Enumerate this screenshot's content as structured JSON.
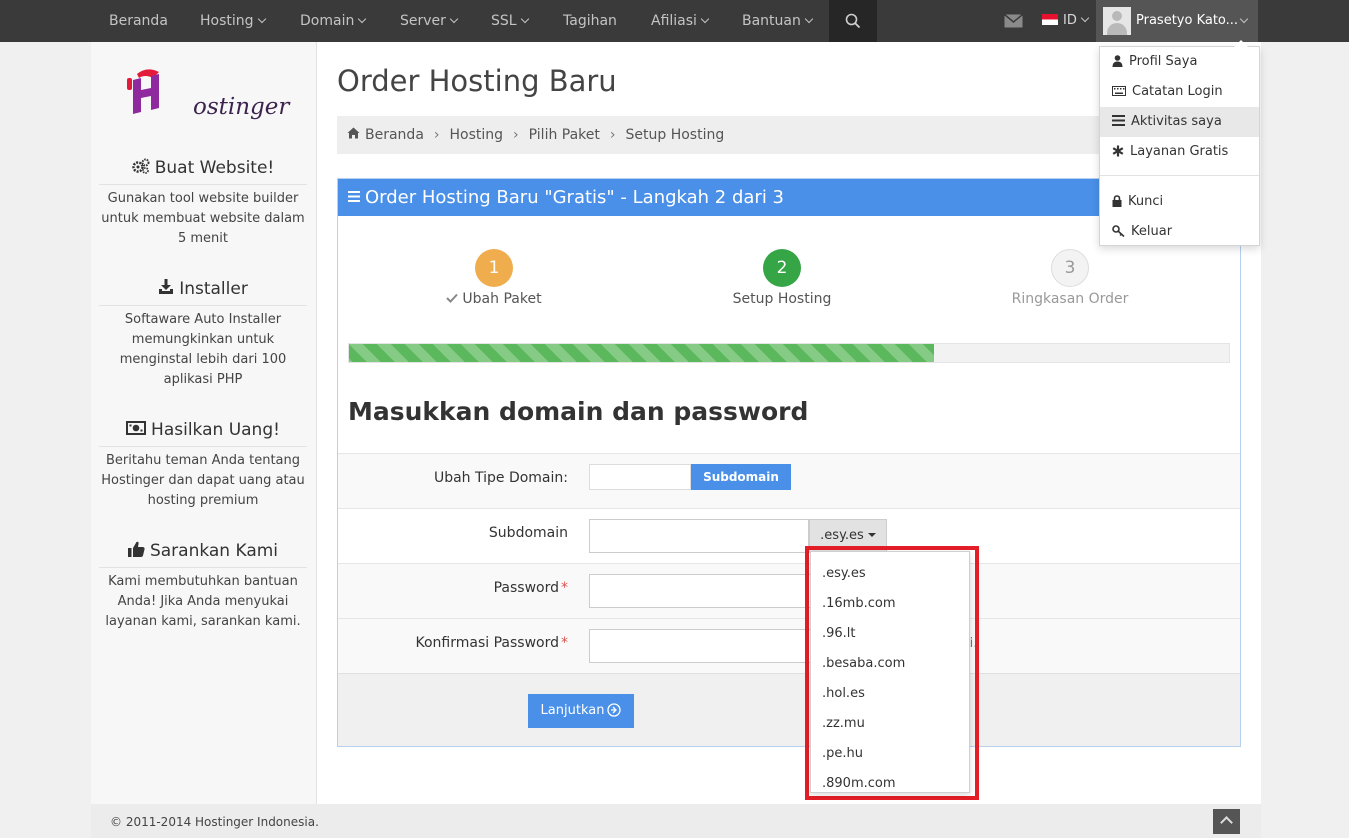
{
  "nav": {
    "items": [
      {
        "label": "Beranda",
        "has_menu": false
      },
      {
        "label": "Hosting",
        "has_menu": true
      },
      {
        "label": "Domain",
        "has_menu": true
      },
      {
        "label": "Server",
        "has_menu": true
      },
      {
        "label": "SSL",
        "has_menu": true
      },
      {
        "label": "Tagihan",
        "has_menu": false
      },
      {
        "label": "Afiliasi",
        "has_menu": true
      },
      {
        "label": "Bantuan",
        "has_menu": true
      }
    ],
    "search_icon": "search-icon",
    "mail_icon": "envelope-icon",
    "language": "ID",
    "user_name": "Prasetyo Kato..."
  },
  "user_menu": {
    "items": [
      {
        "label": "Profil Saya",
        "icon": "user-icon"
      },
      {
        "label": "Catatan Login",
        "icon": "keyboard-icon"
      },
      {
        "label": "Aktivitas saya",
        "icon": "list-icon",
        "active": true
      },
      {
        "label": "Layanan Gratis",
        "icon": "asterisk-icon"
      },
      {
        "label": "Kunci",
        "icon": "lock-icon"
      },
      {
        "label": "Keluar",
        "icon": "key-icon"
      }
    ]
  },
  "sidebar": {
    "logo_text": "ostinger",
    "sections": [
      {
        "title": "Buat Website!",
        "icon": "cogs-icon",
        "text": "Gunakan tool website builder untuk membuat website dalam 5 menit"
      },
      {
        "title": "Installer",
        "icon": "download-icon",
        "text": "Softaware Auto Installer memungkinkan untuk menginstal lebih dari 100 aplikasi PHP"
      },
      {
        "title": "Hasilkan Uang!",
        "icon": "money-icon",
        "text": "Beritahu teman Anda tentang Hostinger dan dapat uang atau hosting premium"
      },
      {
        "title": "Sarankan Kami",
        "icon": "thumbs-up-icon",
        "text": "Kami membutuhkan bantuan Anda! Jika Anda menyukai layanan kami, sarankan kami."
      }
    ]
  },
  "main": {
    "page_title": "Order Hosting Baru",
    "breadcrumb": [
      "Beranda",
      "Hosting",
      "Pilih Paket",
      "Setup Hosting"
    ],
    "panel_title": "Order Hosting Baru \"Gratis\" - Langkah 2 dari 3",
    "steps": [
      {
        "number": "1",
        "label": "Ubah Paket",
        "done": true,
        "color": "#f0ad4e"
      },
      {
        "number": "2",
        "label": "Setup Hosting",
        "done": false,
        "color": "#35a546"
      },
      {
        "number": "3",
        "label": "Ringkasan Order",
        "done": false,
        "color": "#f3f3f3"
      }
    ],
    "progress": 0.665,
    "section_title": "Masukkan domain dan password",
    "form": {
      "domain_type_label": "Ubah Tipe Domain:",
      "domain_type_button": "Subdomain",
      "subdomain_label": "Subdomain",
      "subdomain_value": "",
      "subdomain_selected_tld": ".esy.es",
      "password_label": "Password",
      "confirm_label": "Konfirmasi Password",
      "hint_tail": "li.",
      "submit_label": "Lanjutkan"
    },
    "tld_options": [
      ".esy.es",
      ".16mb.com",
      ".96.lt",
      ".besaba.com",
      ".hol.es",
      ".zz.mu",
      ".pe.hu",
      ".890m.com"
    ]
  },
  "footer": {
    "copyright": "© 2011-2014 Hostinger Indonesia."
  },
  "colors": {
    "accent": "#4a90e8",
    "nav_bg": "#3a3a3a",
    "highlight": "#e41e26",
    "success": "#5cb85c"
  }
}
